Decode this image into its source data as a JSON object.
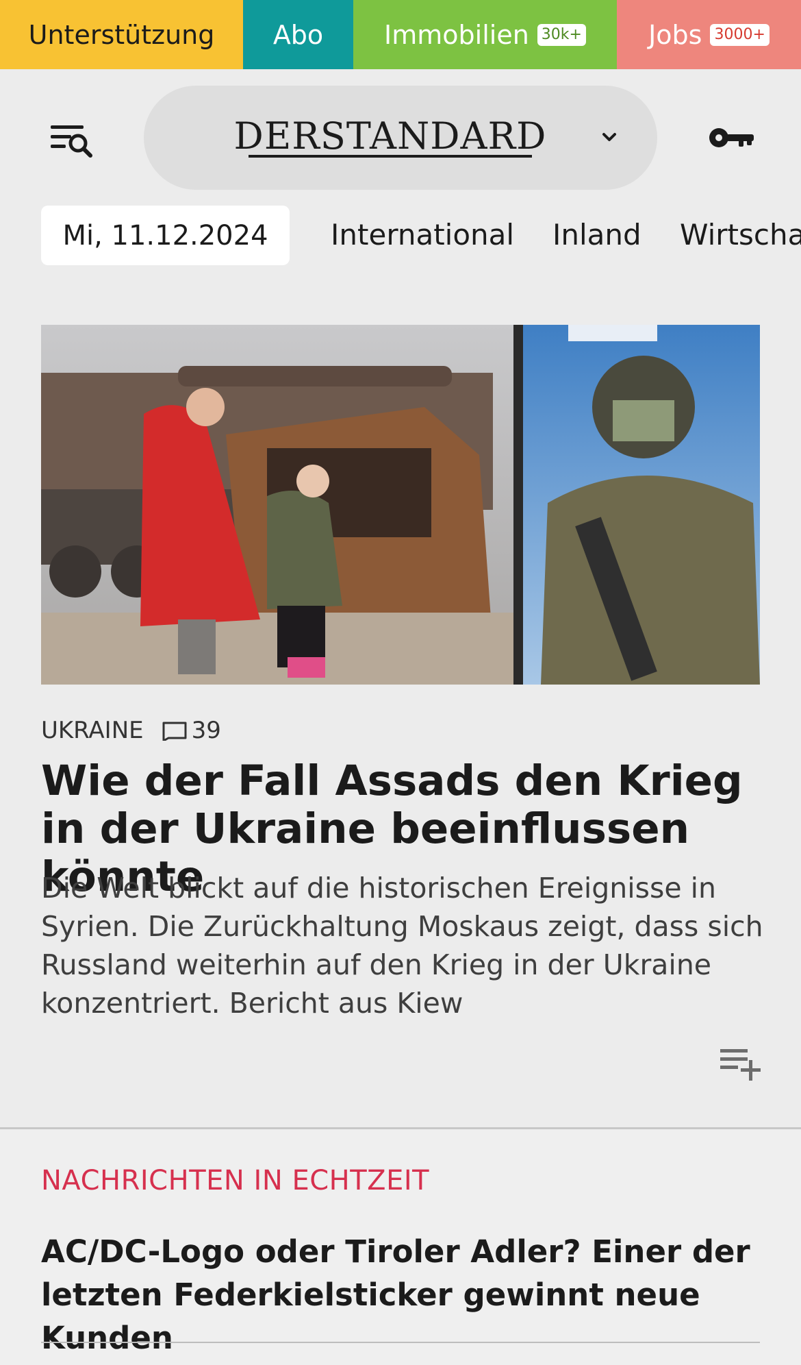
{
  "topbar": {
    "support": "Unterstützung",
    "abo": "Abo",
    "immobilien": "Immobilien",
    "immobilien_badge": "30k+",
    "jobs": "Jobs",
    "jobs_badge": "3000+",
    "colors": {
      "support": "#f8c233",
      "abo": "#0f9a9a",
      "immobilien": "#7dc242",
      "jobs": "#ee867d"
    }
  },
  "header": {
    "logo": "DERSTANDARD",
    "menu_icon": "menu-search-icon",
    "chevron_icon": "chevron-down-icon",
    "login_icon": "key-icon"
  },
  "nav": {
    "date": "Mi, 11.12.2024",
    "items": [
      "International",
      "Inland",
      "Wirtscha"
    ]
  },
  "article": {
    "kicker": "UKRAINE",
    "comments": "39",
    "headline": "Wie der Fall Assads den Krieg in der Ukraine beeinflussen könnte",
    "teaser": "Die Welt blickt auf die historischen Ereignisse in Syrien. Die Zurückhaltung Moskaus zeigt, dass sich Russland weiterhin auf den Krieg in der Ukraine konzentriert. Bericht aus Kiew",
    "playlist_icon": "playlist-add-icon"
  },
  "live": {
    "label": "NACHRICHTEN IN ECHTZEIT",
    "label_color": "#d6304e",
    "title": "AC/DC-Logo oder Tiroler Adler? Einer der letzten Federkielsticker gewinnt neue Kunden"
  }
}
